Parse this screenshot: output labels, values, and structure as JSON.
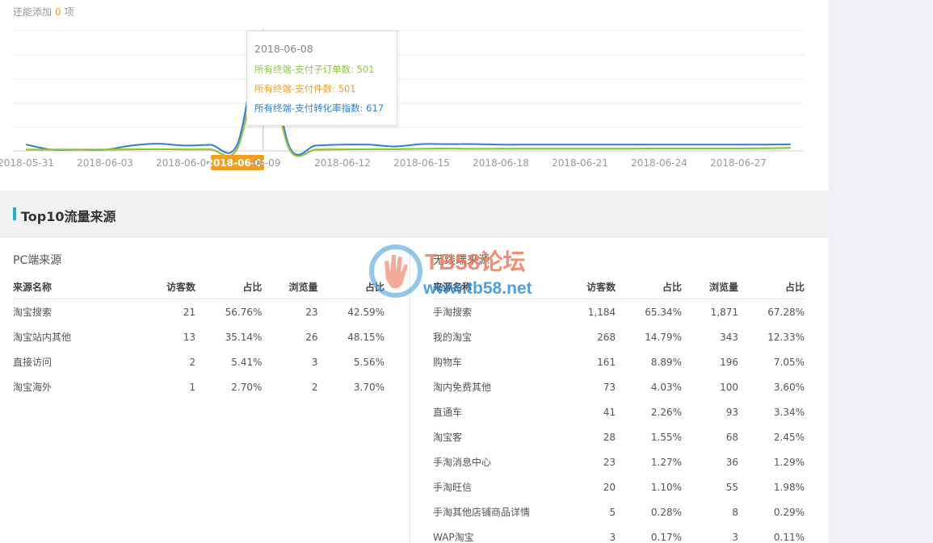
{
  "remaining": {
    "prefix": "还能添加",
    "count": "0",
    "suffix": "项"
  },
  "chart_data": {
    "type": "line",
    "x_labels": [
      "2018-05-31",
      "2018-06-03",
      "2018-06-06",
      "2018-06-08",
      "2018-06-09",
      "2018-06-12",
      "2018-06-15",
      "2018-06-18",
      "2018-06-21",
      "2018-06-24",
      "2018-06-27"
    ],
    "highlight_label": "2018-06-08",
    "series": [
      {
        "name": "所有终端-支付转化率指数",
        "color": "#2f7fd8",
        "values": [
          31,
          2,
          2,
          2,
          25,
          35,
          25,
          29,
          26,
          617,
          16,
          25,
          30,
          30,
          20,
          33,
          33,
          33,
          30,
          30,
          30,
          30,
          30,
          30,
          30,
          30,
          30,
          30,
          30,
          32
        ]
      },
      {
        "name": "所有终端-支付件数",
        "color": "#f0a020",
        "values": [
          3,
          3,
          3,
          3,
          4,
          5,
          4,
          4,
          4,
          501,
          3,
          3,
          4,
          5,
          5,
          7,
          9,
          7,
          8,
          8,
          8,
          8,
          8,
          8,
          9,
          9,
          9,
          9,
          10,
          12
        ]
      },
      {
        "name": "所有终端-支付子订单数",
        "color": "#8cc63e",
        "values": [
          3,
          3,
          3,
          3,
          4,
          5,
          4,
          4,
          4,
          501,
          3,
          3,
          4,
          5,
          5,
          7,
          9,
          7,
          8,
          8,
          8,
          8,
          8,
          8,
          9,
          9,
          9,
          9,
          10,
          12
        ]
      }
    ],
    "tooltip": {
      "date": "2018-06-08",
      "lines": [
        "所有终端-支付子订单数: 501",
        "所有终端-支付件数: 501",
        "所有终端-支付转化率指数: 617"
      ]
    },
    "grid": true
  },
  "section_title": "Top10流量来源",
  "pc": {
    "title": "PC端来源",
    "headers": [
      "来源名称",
      "访客数",
      "占比",
      "浏览量",
      "占比"
    ],
    "rows": [
      [
        "淘宝搜索",
        "21",
        "56.76%",
        "23",
        "42.59%"
      ],
      [
        "淘宝站内其他",
        "13",
        "35.14%",
        "26",
        "48.15%"
      ],
      [
        "直接访问",
        "2",
        "5.41%",
        "3",
        "5.56%"
      ],
      [
        "淘宝海外",
        "1",
        "2.70%",
        "2",
        "3.70%"
      ]
    ]
  },
  "wireless": {
    "title": "无线端来源",
    "headers": [
      "来源名称",
      "访客数",
      "占比",
      "浏览量",
      "占比"
    ],
    "rows": [
      [
        "手淘搜索",
        "1,184",
        "65.34%",
        "1,871",
        "67.28%"
      ],
      [
        "我的淘宝",
        "268",
        "14.79%",
        "343",
        "12.33%"
      ],
      [
        "购物车",
        "161",
        "8.89%",
        "196",
        "7.05%"
      ],
      [
        "淘内免费其他",
        "73",
        "4.03%",
        "100",
        "3.60%"
      ],
      [
        "直通车",
        "41",
        "2.26%",
        "93",
        "3.34%"
      ],
      [
        "淘宝客",
        "28",
        "1.55%",
        "68",
        "2.45%"
      ],
      [
        "手淘消息中心",
        "23",
        "1.27%",
        "36",
        "1.29%"
      ],
      [
        "手淘旺信",
        "20",
        "1.10%",
        "55",
        "1.98%"
      ],
      [
        "手淘其他店铺商品详情",
        "5",
        "0.28%",
        "8",
        "0.29%"
      ],
      [
        "WAP淘宝",
        "3",
        "0.17%",
        "3",
        "0.11%"
      ]
    ]
  },
  "watermark": {
    "title": "TB58论坛",
    "url": "www.tb58.net"
  }
}
